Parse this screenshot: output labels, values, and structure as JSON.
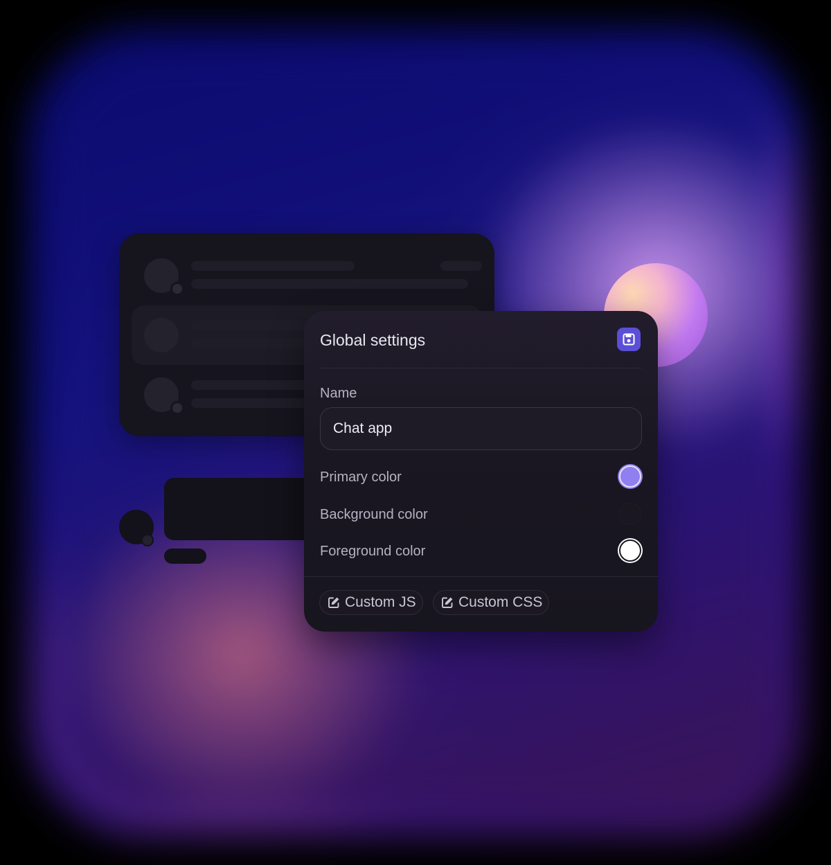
{
  "settings": {
    "title": "Global settings",
    "save_icon": "floppy-disk-icon",
    "name_label": "Name",
    "name_value": "Chat app",
    "colors": [
      {
        "label": "Primary color",
        "value": "#8f7ff0"
      },
      {
        "label": "Background color",
        "value": "#1a1721"
      },
      {
        "label": "Foreground color",
        "value": "#ffffff"
      }
    ],
    "actions": [
      {
        "label": "Custom JS",
        "icon": "edit-icon"
      },
      {
        "label": "Custom CSS",
        "icon": "edit-icon"
      }
    ]
  },
  "theme": {
    "accent": "#5b4fd6",
    "card_background": "#1a1722",
    "backdrop_blue": "#10107a",
    "backdrop_purple": "#c27af0",
    "backdrop_rose": "#be5f78"
  }
}
